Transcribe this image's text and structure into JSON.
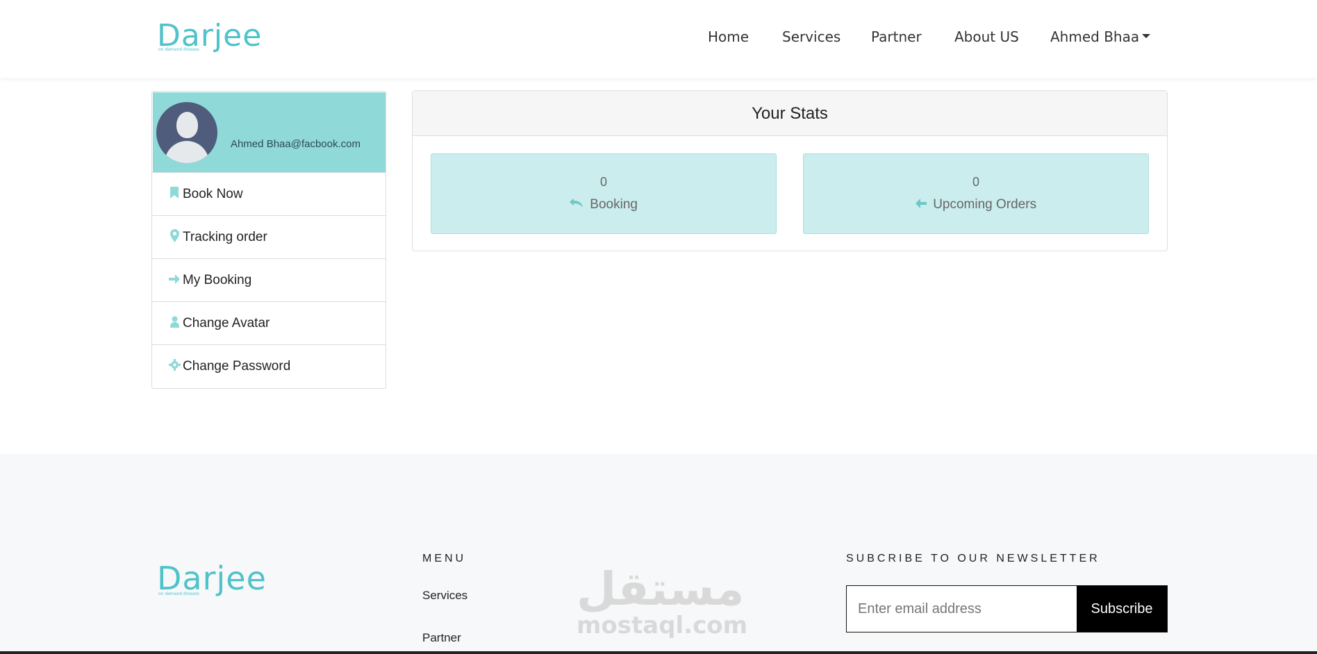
{
  "brand": {
    "name": "Darjee",
    "tagline": "on demand dresses"
  },
  "nav": {
    "items": [
      "Home",
      "Services",
      "Partner",
      "About US"
    ],
    "user": "Ahmed Bhaa"
  },
  "profile": {
    "email": "Ahmed Bhaa@facbook.com"
  },
  "sidebar": {
    "items": [
      {
        "label": "Book Now",
        "icon": "bookmark-icon"
      },
      {
        "label": "Tracking order",
        "icon": "map-marker-icon"
      },
      {
        "label": "My Booking",
        "icon": "arrow-right-icon"
      },
      {
        "label": "Change Avatar",
        "icon": "user-icon"
      },
      {
        "label": "Change Password",
        "icon": "gear-icon"
      }
    ]
  },
  "stats": {
    "title": "Your Stats",
    "booking": {
      "value": "0",
      "label": "Booking"
    },
    "upcoming": {
      "value": "0",
      "label": "Upcoming Orders"
    }
  },
  "footer": {
    "menu_title": "MENU",
    "menu_items": [
      "Services",
      "Partner"
    ],
    "watermark": {
      "arabic": "مستقل",
      "latin": "mostaql.com"
    },
    "newsletter_title": "SUBCRIBE TO OUR NEWSLETTER",
    "email_placeholder": "Enter email address",
    "subscribe_label": "Subscribe"
  },
  "colors": {
    "accent": "#8fd9d9",
    "stat_box": "#cbeded",
    "logo": "#4fc3c9"
  }
}
